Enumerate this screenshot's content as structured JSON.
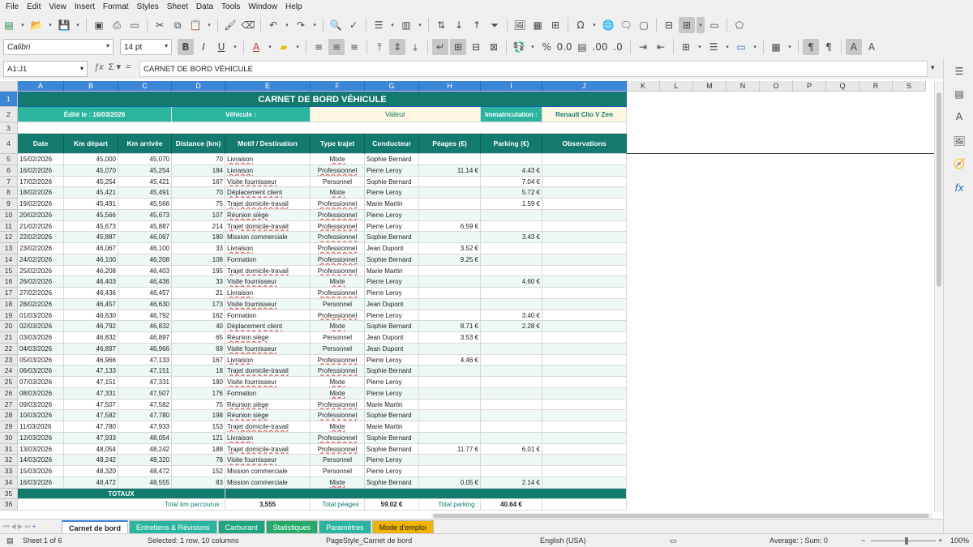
{
  "menu": [
    "File",
    "Edit",
    "View",
    "Insert",
    "Format",
    "Styles",
    "Sheet",
    "Data",
    "Tools",
    "Window",
    "Help"
  ],
  "toolbar": {
    "font_name": "Calibri",
    "font_size": "14 pt"
  },
  "formula_bar": {
    "name_box": "A1:J1",
    "content": "CARNET DE BORD VÉHICULE"
  },
  "columns": [
    "A",
    "B",
    "C",
    "D",
    "E",
    "F",
    "G",
    "H",
    "I",
    "J",
    "K",
    "L",
    "M",
    "N",
    "O",
    "P",
    "Q",
    "R",
    "S"
  ],
  "sheet": {
    "title": "CARNET DE BORD VÉHICULE",
    "edited_label": "Édité le : 16/03/2026",
    "vehicle_label": "Véhicule :",
    "vehicle_value": "Valeur",
    "plate_label": "Immatriculation :",
    "plate_value": "Renault Clio V Zen",
    "headers": [
      "Date",
      "Km départ",
      "Km arrivée",
      "Distance (km)",
      "Motif / Destination",
      "Type trajet",
      "Conducteur",
      "Péages (€)",
      "Parking (€)",
      "Observations"
    ],
    "rows": [
      [
        "15/02/2026",
        "45,000",
        "45,070",
        "70",
        "Livraison",
        "Mixte",
        "Sophie Bernard",
        "",
        ""
      ],
      [
        "16/02/2026",
        "45,070",
        "45,254",
        "184",
        "Livraison",
        "Professionnel",
        "Pierre Leroy",
        "11.14 €",
        "4.43 €"
      ],
      [
        "17/02/2026",
        "45,254",
        "45,421",
        "167",
        "Visite fournisseur",
        "Personnel",
        "Sophie Bernard",
        "",
        "7.04 €"
      ],
      [
        "18/02/2026",
        "45,421",
        "45,491",
        "70",
        "Déplacement client",
        "Mixte",
        "Pierre Leroy",
        "",
        "5.72 €"
      ],
      [
        "19/02/2026",
        "45,491",
        "45,566",
        "75",
        "Trajet domicile-travail",
        "Professionnel",
        "Marie Martin",
        "",
        "1.59 €"
      ],
      [
        "20/02/2026",
        "45,566",
        "45,673",
        "107",
        "Réunion siège",
        "Professionnel",
        "Pierre Leroy",
        "",
        ""
      ],
      [
        "21/02/2026",
        "45,673",
        "45,887",
        "214",
        "Trajet domicile-travail",
        "Professionnel",
        "Pierre Leroy",
        "6.59 €",
        ""
      ],
      [
        "22/02/2026",
        "45,887",
        "46,067",
        "180",
        "Mission commerciale",
        "Professionnel",
        "Sophie Bernard",
        "",
        "3.43 €"
      ],
      [
        "23/02/2026",
        "46,067",
        "46,100",
        "33",
        "Livraison",
        "Professionnel",
        "Jean Dupont",
        "3.52 €",
        ""
      ],
      [
        "24/02/2026",
        "46,100",
        "46,208",
        "108",
        "Formation",
        "Professionnel",
        "Sophie Bernard",
        "9.25 €",
        ""
      ],
      [
        "25/02/2026",
        "46,208",
        "46,403",
        "195",
        "Trajet domicile-travail",
        "Professionnel",
        "Marie Martin",
        "",
        ""
      ],
      [
        "26/02/2026",
        "46,403",
        "46,436",
        "33",
        "Visite fournisseur",
        "Mixte",
        "Pierre Leroy",
        "",
        "4.60 €"
      ],
      [
        "27/02/2026",
        "46,436",
        "46,457",
        "21",
        "Livraison",
        "Professionnel",
        "Pierre Leroy",
        "",
        ""
      ],
      [
        "28/02/2026",
        "46,457",
        "46,630",
        "173",
        "Visite fournisseur",
        "Personnel",
        "Jean Dupont",
        "",
        ""
      ],
      [
        "01/03/2026",
        "46,630",
        "46,792",
        "162",
        "Formation",
        "Professionnel",
        "Pierre Leroy",
        "",
        "3.40 €"
      ],
      [
        "02/03/2026",
        "46,792",
        "46,832",
        "40",
        "Déplacement client",
        "Mixte",
        "Sophie Bernard",
        "8.71 €",
        "2.28 €"
      ],
      [
        "03/03/2026",
        "46,832",
        "46,897",
        "65",
        "Réunion siège",
        "Personnel",
        "Jean Dupont",
        "3.53 €",
        ""
      ],
      [
        "04/03/2026",
        "46,897",
        "46,966",
        "69",
        "Visite fournisseur",
        "Personnel",
        "Jean Dupont",
        "",
        ""
      ],
      [
        "05/03/2026",
        "46,966",
        "47,133",
        "167",
        "Livraison",
        "Professionnel",
        "Pierre Leroy",
        "4.46 €",
        ""
      ],
      [
        "06/03/2026",
        "47,133",
        "47,151",
        "18",
        "Trajet domicile-travail",
        "Professionnel",
        "Sophie Bernard",
        "",
        ""
      ],
      [
        "07/03/2026",
        "47,151",
        "47,331",
        "180",
        "Visite fournisseur",
        "Mixte",
        "Pierre Leroy",
        "",
        ""
      ],
      [
        "08/03/2026",
        "47,331",
        "47,507",
        "176",
        "Formation",
        "Mixte",
        "Pierre Leroy",
        "",
        ""
      ],
      [
        "09/03/2026",
        "47,507",
        "47,582",
        "75",
        "Réunion siège",
        "Professionnel",
        "Marie Martin",
        "",
        ""
      ],
      [
        "10/03/2026",
        "47,582",
        "47,780",
        "198",
        "Réunion siège",
        "Professionnel",
        "Sophie Bernard",
        "",
        ""
      ],
      [
        "11/03/2026",
        "47,780",
        "47,933",
        "153",
        "Trajet domicile-travail",
        "Mixte",
        "Marie Martin",
        "",
        ""
      ],
      [
        "12/03/2026",
        "47,933",
        "48,054",
        "121",
        "Livraison",
        "Professionnel",
        "Sophie Bernard",
        "",
        ""
      ],
      [
        "13/03/2026",
        "48,054",
        "48,242",
        "188",
        "Trajet domicile-travail",
        "Professionnel",
        "Sophie Bernard",
        "11.77 €",
        "6.01 €"
      ],
      [
        "14/03/2026",
        "48,242",
        "48,320",
        "78",
        "Visite fournisseur",
        "Personnel",
        "Pierre Leroy",
        "",
        ""
      ],
      [
        "15/03/2026",
        "48,320",
        "48,472",
        "152",
        "Mission commerciale",
        "Personnel",
        "Pierre Leroy",
        "",
        ""
      ],
      [
        "16/03/2026",
        "48,472",
        "48,555",
        "83",
        "Mission commerciale",
        "Mixte",
        "Sophie Bernard",
        "0.05 €",
        "2.14 €"
      ]
    ],
    "totals_label": "TOTAUX",
    "total_km_label": "Total km parcourus :",
    "total_km_value": "3,555",
    "total_tolls_label": "Total péages :",
    "total_tolls_value": "59.02 €",
    "total_parking_label": "Total parking :",
    "total_parking_value": "40.64 €"
  },
  "tabs": [
    "Carnet de bord",
    "Entretiens & Révisions",
    "Carburant",
    "Statistiques",
    "Paramètres",
    "Mode d'emploi"
  ],
  "tab_colors": [
    "#ffffff",
    "#2bb59f",
    "#1ea57f",
    "#26a96b",
    "#2bb59f",
    "#f0b400"
  ],
  "status": {
    "sheet": "Sheet 1 of 6",
    "selection": "Selected: 1 row, 10 columns",
    "page_style": "PageStyle_Carnet de bord",
    "language": "English (USA)",
    "calc": "Average: ; Sum: 0",
    "zoom": "100%"
  }
}
